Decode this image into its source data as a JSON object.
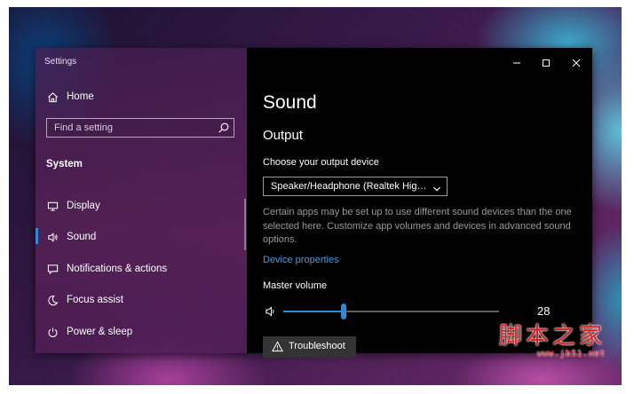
{
  "window": {
    "title": "Settings"
  },
  "sidebar": {
    "home_label": "Home",
    "search_placeholder": "Find a setting",
    "section_title": "System",
    "items": [
      {
        "label": "Display",
        "icon": "monitor-icon"
      },
      {
        "label": "Sound",
        "icon": "speaker-icon",
        "selected": true
      },
      {
        "label": "Notifications & actions",
        "icon": "notification-icon"
      },
      {
        "label": "Focus assist",
        "icon": "moon-icon"
      },
      {
        "label": "Power & sleep",
        "icon": "power-icon"
      }
    ]
  },
  "content": {
    "page_title": "Sound",
    "section_output": "Output",
    "choose_label": "Choose your output device",
    "output_device": "Speaker/Headphone (Realtek Hig…",
    "description": "Certain apps may be set up to use different sound devices than the one selected here. Customize app volumes and devices in advanced sound options.",
    "device_properties_link": "Device properties",
    "master_volume_label": "Master volume",
    "master_volume_value": "28",
    "master_volume_percent": 28,
    "troubleshoot_label": "Troubleshoot"
  },
  "watermark": {
    "text": "脚本之家",
    "url": "www.jb51.net"
  },
  "colors": {
    "accent": "#2e89d6",
    "link": "#4a9be0",
    "watermark": "#d91f1f"
  }
}
